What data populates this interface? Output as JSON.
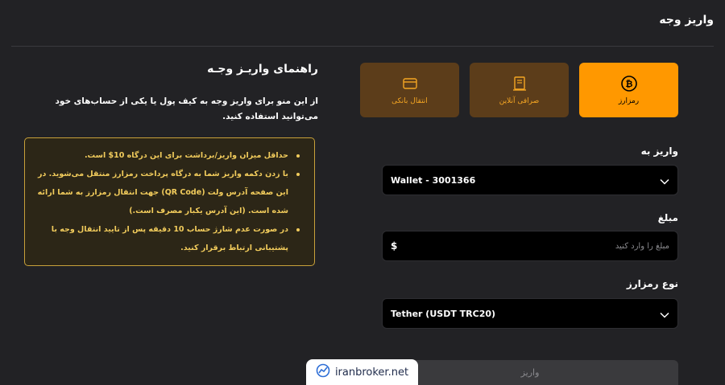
{
  "header": {
    "title": "واریز وجه"
  },
  "methods": [
    {
      "label": "رمزارز",
      "icon": "bitcoin-icon",
      "active": true
    },
    {
      "label": "صرافی آنلاین",
      "icon": "receipt-icon",
      "active": false
    },
    {
      "label": "انتقال بانکی",
      "icon": "card-icon",
      "active": false
    }
  ],
  "form": {
    "deposit_to_label": "واریز به",
    "deposit_to_value": "Wallet - 3001366",
    "amount_label": "مبلغ",
    "amount_placeholder": "مبلغ را وارد کنید",
    "currency_symbol": "$",
    "crypto_type_label": "نوع رمزارز",
    "crypto_type_value": "Tether (USDT TRC20)",
    "submit_label": "واریز"
  },
  "guide": {
    "title": "راهنمای واریـز وجـه",
    "description": "از این منو برای واریز وجه به کیف پول یا یکی از حساب‌های خود می‌توانید استفاده کنید.",
    "notes": [
      "حداقل میزان واریز/برداشت برای این درگاه 10$ است.",
      "با زدن دکمه واریز شما به درگاه پرداخت رمزارز منتقل می‌شوید. در این صفحه آدرس ولت (QR Code) جهت انتقال رمزارز به شما ارائه شده است. (این آدرس یکبار مصرف است.)",
      "در صورت عدم شارژ حساب 10 دقیقه پس از تایید انتقال وجه با پشتیبانی ارتباط برقرار کنید."
    ]
  },
  "watermark": {
    "text": "iranbroker.net"
  },
  "colors": {
    "accent": "#ff9800",
    "inactive_card": "#5c3d1a",
    "notice_border": "#c8a13a",
    "notice_text": "#f2cc5c",
    "background": "#222225"
  }
}
